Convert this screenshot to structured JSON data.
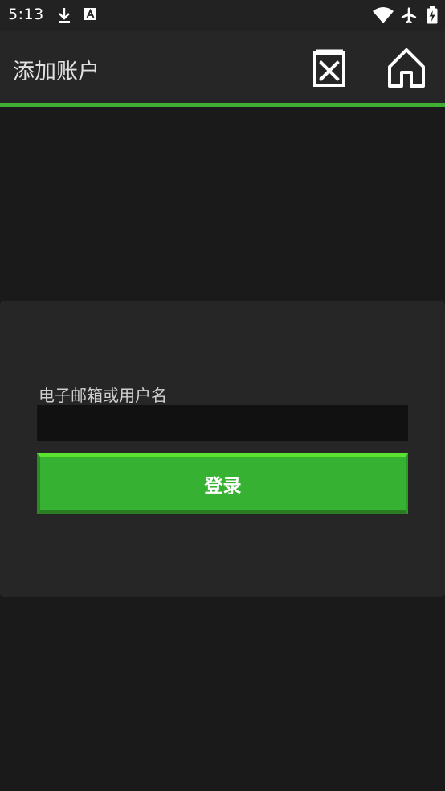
{
  "status_bar": {
    "time": "5:13",
    "left_icons": [
      "download-icon",
      "a-box-icon"
    ],
    "right_icons": [
      "wifi-icon",
      "airplane-icon",
      "battery-charging-icon"
    ]
  },
  "app_bar": {
    "title": "添加账户",
    "actions": [
      "delete-icon",
      "home-icon"
    ],
    "accent_color": "#3fae33"
  },
  "login_form": {
    "field_label": "电子邮箱或用户名",
    "field_value": "",
    "submit_label": "登录",
    "button_color": "#36b131"
  }
}
